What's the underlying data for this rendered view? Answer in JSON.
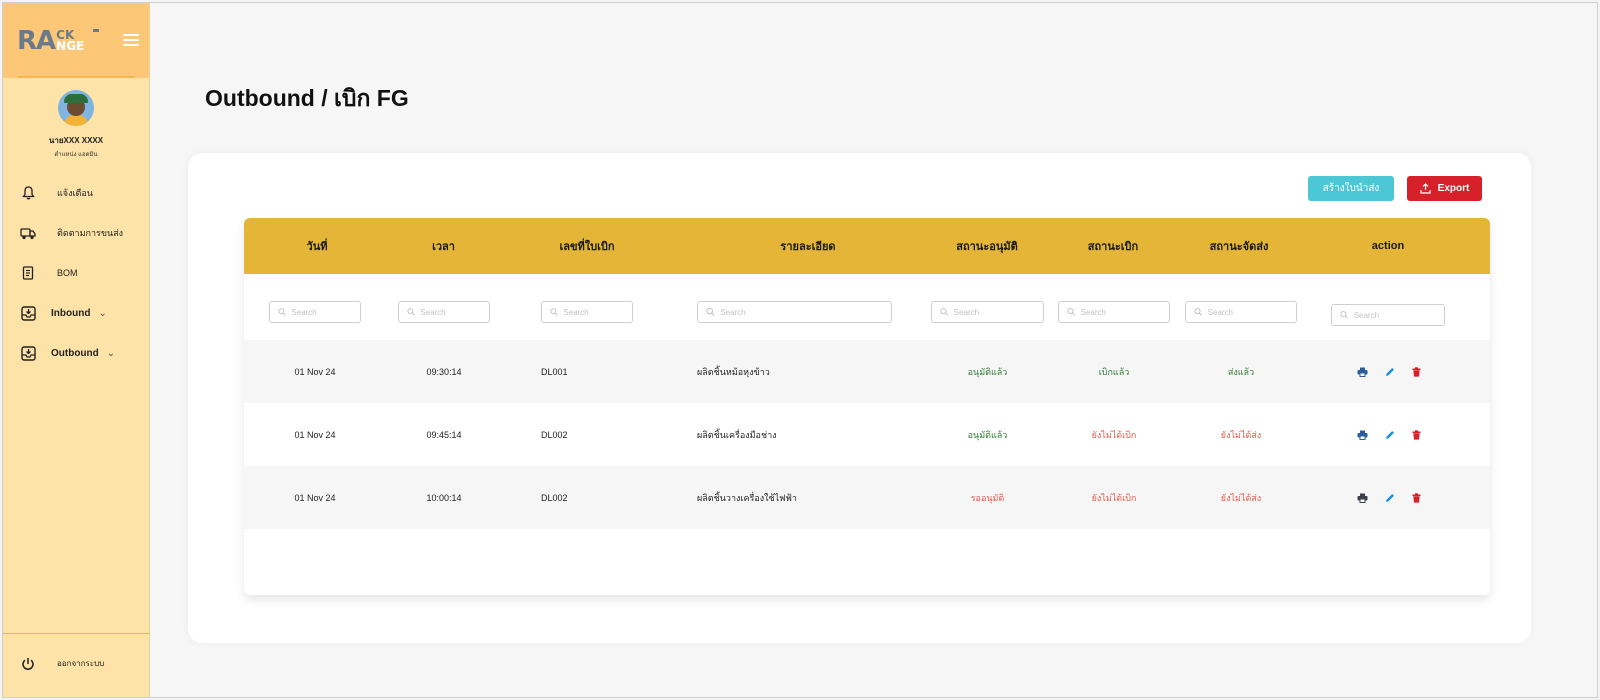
{
  "sidebar": {
    "logo": {
      "ra": "RA",
      "ck": "CK",
      "nge": "NGE"
    },
    "profile": {
      "name": "นายXXX XXXX",
      "role": "ตำแหน่ง แอดมิน"
    },
    "items": [
      {
        "label": "แจ้งเตือน",
        "icon": "bell-icon"
      },
      {
        "label": "ติดตามการขนส่ง",
        "icon": "truck-icon"
      },
      {
        "label": "BOM",
        "icon": "document-icon"
      },
      {
        "label": "Inbound",
        "icon": "inbox-icon",
        "expandable": true
      },
      {
        "label": "Outbound",
        "icon": "inbox-icon",
        "expandable": true
      }
    ],
    "logout": "ออกจากระบบ"
  },
  "page": {
    "title": "Outbound / เบิก FG"
  },
  "toolbar": {
    "create_label": "สร้างใบนำส่ง",
    "export_label": "Export"
  },
  "table": {
    "columns": [
      "วันที่",
      "เวลา",
      "เลขที่ใบเบิก",
      "รายละเอียด",
      "สถานะอนุมัติ",
      "สถานะเบิก",
      "สถานะจัดส่ง",
      "action"
    ],
    "search_placeholder": "Search",
    "rows": [
      {
        "date": "01 Nov 24",
        "time": "09:30:14",
        "doc_no": "DL001",
        "detail": "ผลิตชิ้นหม้อหุงข้าว",
        "approve": "อนุมัติแล้ว",
        "withdraw": "เบิกแล้ว",
        "ship": "ส่งแล้ว"
      },
      {
        "date": "01 Nov 24",
        "time": "09:45:14",
        "doc_no": "DL002",
        "detail": "ผลิตชิ้นเครื่องมือช่าง",
        "approve": "อนุมัติแล้ว",
        "withdraw": "ยังไม่ได้เบิก",
        "ship": "ยังไม่ได้ส่ง"
      },
      {
        "date": "01 Nov 24",
        "time": "10:00:14",
        "doc_no": "DL002",
        "detail": "ผลิตชิ้นวางเครื่องใช้ไฟฟ้า",
        "approve": "รออนุมัติ",
        "withdraw": "ยังไม่ได้เบิก",
        "ship": "ยังไม่ได้ส่ง"
      }
    ]
  },
  "colors": {
    "sidebar_bg": "#fde3a7",
    "brand_bg": "#fcc877",
    "header_bg": "#e4b537",
    "create_btn": "#4cc7d6",
    "export_btn": "#d6202a",
    "status_ok": "#2e7d32",
    "status_pending": "#e05a4a",
    "print_icon": "#2b5d9a",
    "edit_icon": "#1a8fe0",
    "delete_icon": "#d6202a"
  }
}
